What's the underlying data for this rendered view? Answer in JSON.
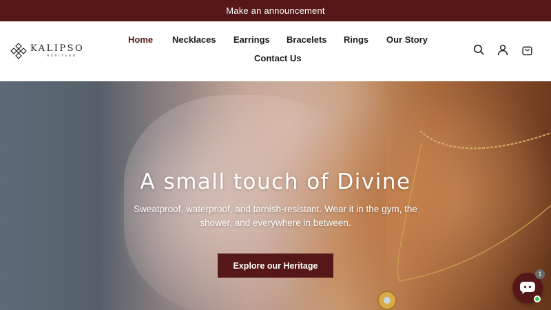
{
  "announcement": {
    "text": "Make an announcement"
  },
  "brand": {
    "name": "KALIPSO",
    "tagline": "HERITAGE"
  },
  "nav": {
    "items": [
      {
        "label": "Home",
        "active": true
      },
      {
        "label": "Necklaces",
        "active": false
      },
      {
        "label": "Earrings",
        "active": false
      },
      {
        "label": "Bracelets",
        "active": false
      },
      {
        "label": "Rings",
        "active": false
      },
      {
        "label": "Our Story",
        "active": false
      },
      {
        "label": "Contact Us",
        "active": false
      }
    ]
  },
  "header_icons": [
    "search-icon",
    "account-icon",
    "cart-icon"
  ],
  "hero": {
    "title": "A small touch of Divine",
    "subtitle": "Sweatproof, waterproof, and tarnish-resistant. Wear it in the gym, the shower, and everywhere in between.",
    "cta_label": "Explore our Heritage"
  },
  "chat": {
    "badge_count": "1",
    "icon": "chat-icon",
    "status": "online"
  },
  "colors": {
    "brand": "#551717",
    "text": "#1a1a1a",
    "white": "#ffffff",
    "online": "#2ecc40"
  }
}
